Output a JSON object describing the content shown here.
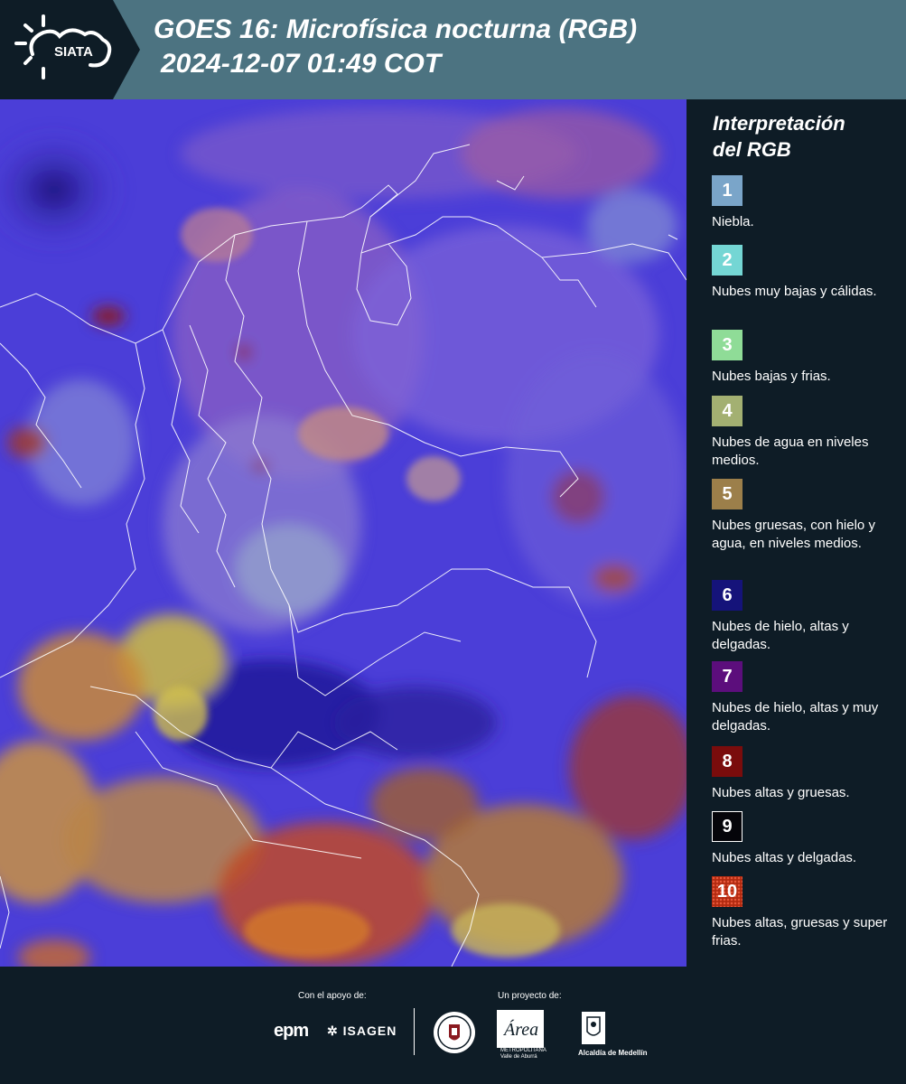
{
  "header": {
    "logo_text": "SIATA",
    "title_line1": "GOES 16: Microfísica nocturna (RGB)",
    "title_line2": "2024-12-07 01:49 COT"
  },
  "map": {
    "image_description": "sun-icon",
    "base_color": "#4a3bd6"
  },
  "legend": {
    "title_line1": "Interpretación",
    "title_line2": "del RGB",
    "items": [
      {
        "number": "1",
        "label": "Niebla.",
        "color": "#7aa5c9"
      },
      {
        "number": "2",
        "label": "Nubes muy bajas y cálidas.",
        "color": "#74d6d4"
      },
      {
        "number": "3",
        "label": "Nubes bajas y frias.",
        "color": "#8fdc97"
      },
      {
        "number": "4",
        "label": "Nubes de agua en niveles medios.",
        "color": "#a3b072"
      },
      {
        "number": "5",
        "label": "Nubes gruesas, con hielo y agua, en niveles medios.",
        "color": "#9c7f4a"
      },
      {
        "number": "6",
        "label": "Nubes de hielo, altas y delgadas.",
        "color": "#15137a"
      },
      {
        "number": "7",
        "label": "Nubes de hielo, altas y muy delgadas.",
        "color": "#5c0e7c"
      },
      {
        "number": "8",
        "label": "Nubes altas y gruesas.",
        "color": "#7a0c0c"
      },
      {
        "number": "9",
        "label": "Nubes altas y delgadas.",
        "color": "#05050a"
      },
      {
        "number": "10",
        "label": "Nubes altas, gruesas y super frias.",
        "color": "#b12a10"
      }
    ]
  },
  "footer": {
    "support_label": "Con el apoyo de:",
    "project_label": "Un proyecto de:",
    "epm": "epm",
    "isagen": "ISAGEN",
    "area_name": "Área",
    "area_caption": "METROPOLITANA Valle de Aburrá",
    "medellin": "Alcaldía de Medellín"
  }
}
